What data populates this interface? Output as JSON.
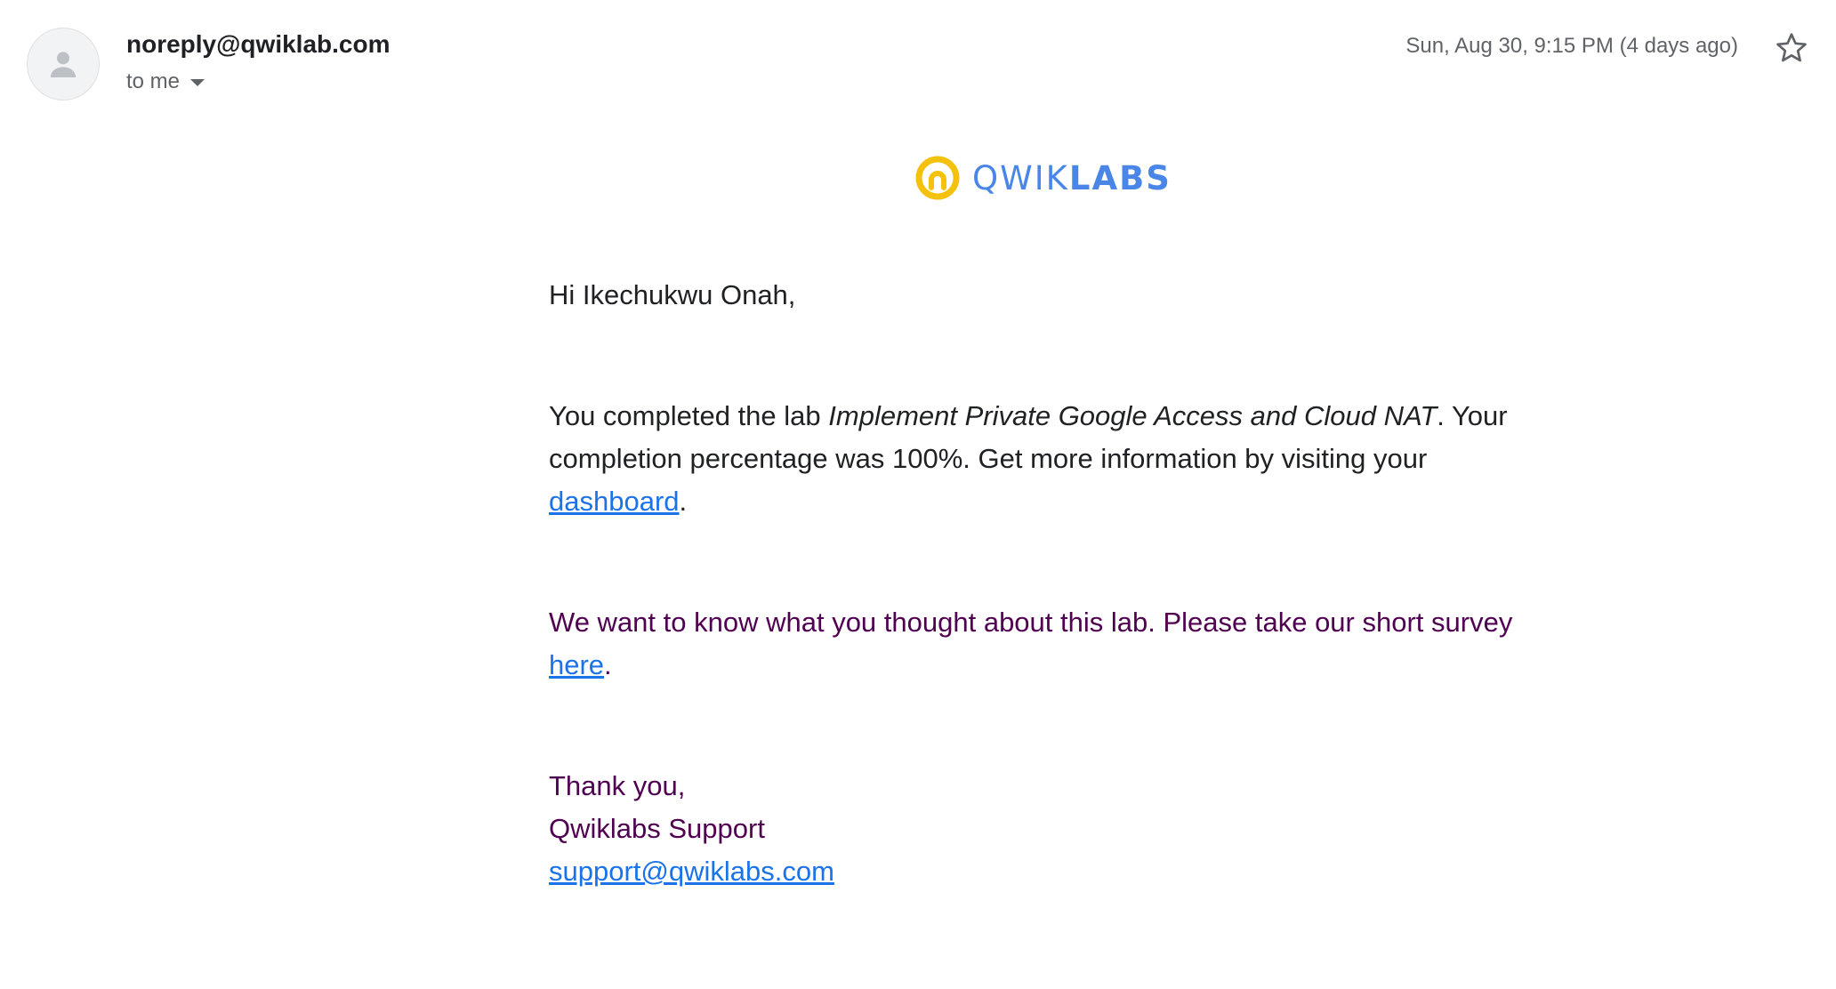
{
  "header": {
    "avatar_icon": "person-icon",
    "sender": "noreply@qwiklab.com",
    "recipient_label": "to me",
    "timestamp": "Sun, Aug 30, 9:15 PM (4 days ago)",
    "star_icon": "star-outline-icon"
  },
  "logo": {
    "icon": "qwiklabs-logo-icon",
    "text_light": "QWIK",
    "text_bold": "LABS",
    "colors": {
      "ring": "#f4c20d",
      "text": "#4a86e8"
    }
  },
  "body": {
    "greeting": "Hi Ikechukwu Onah,",
    "completion_prefix": "You completed the lab ",
    "lab_name": "Implement Private Google Access and Cloud NAT",
    "completion_middle": ". Your completion percentage was 100%. Get more information by visiting your ",
    "dashboard_link": "dashboard",
    "completion_suffix": ".",
    "survey_prefix": "We want to know what you thought about this lab. Please take our short survey ",
    "survey_link": "here",
    "survey_suffix": ".",
    "signoff_thanks": "Thank you,",
    "signoff_team": "Qwiklabs Support",
    "support_email": "support@qwiklabs.com"
  },
  "colors": {
    "link": "#1a73e8",
    "quoted_text": "#500050",
    "secondary_text": "#5f6368"
  }
}
